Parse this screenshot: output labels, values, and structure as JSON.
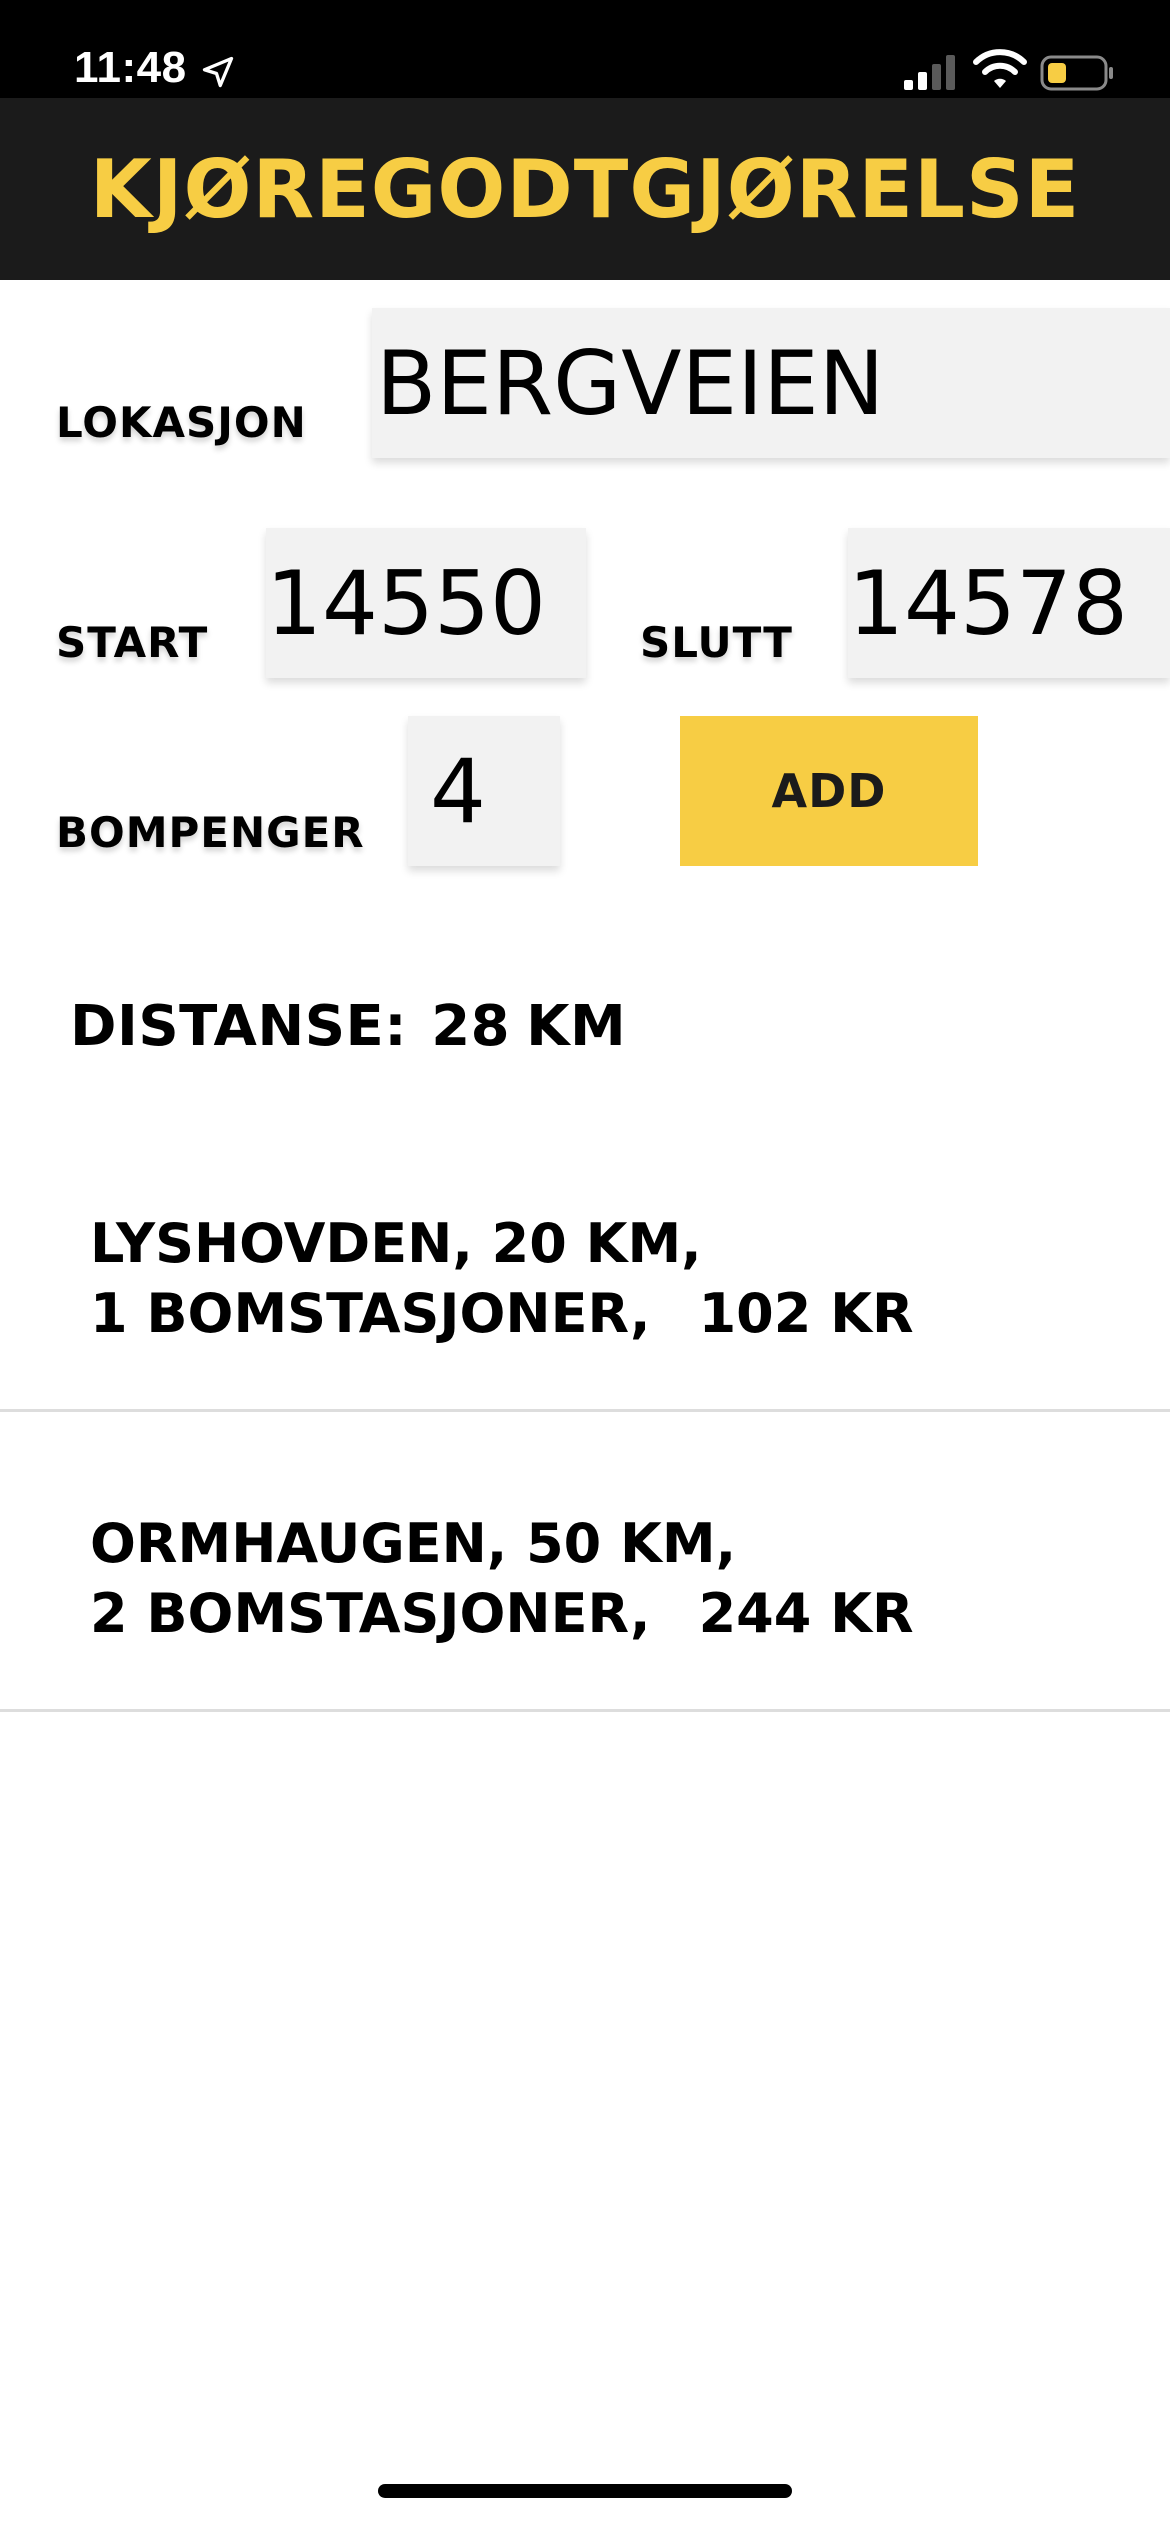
{
  "status_bar": {
    "time": "11:48",
    "icons": [
      "location-arrow-icon",
      "cellular-signal-icon",
      "wifi-icon",
      "battery-icon"
    ],
    "battery_color": "#f7cd44"
  },
  "header": {
    "title": "KJØREGODTGJØRELSE",
    "background": "#1b1b1b",
    "accent": "#f7cd44"
  },
  "form": {
    "lokasjon_label": "LOKASJON",
    "lokasjon_value": "BERGVEIEN",
    "start_label": "START",
    "start_value": "14550",
    "slutt_label": "SLUTT",
    "slutt_value": "14578",
    "bompenger_label": "BOMPENGER",
    "bompenger_value": "4",
    "add_label": "ADD"
  },
  "distance": {
    "label": "DISTANSE:",
    "value": "28",
    "unit": "KM"
  },
  "trips": [
    {
      "line1": "LYSHOVDEN, 20 KM,",
      "stations": "1 BOMSTASJONER,",
      "cost": "102 KR"
    },
    {
      "line1": "ORMHAUGEN, 50 KM,",
      "stations": "2 BOMSTASJONER,",
      "cost": "244 KR"
    }
  ]
}
